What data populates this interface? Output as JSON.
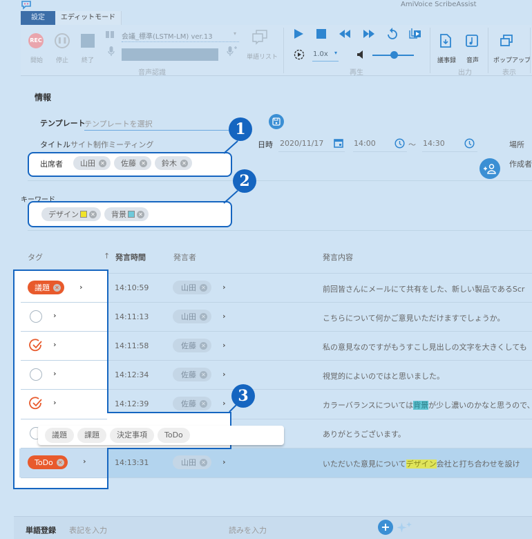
{
  "window": {
    "title": "AmiVoice ScribeAssist"
  },
  "tabs": [
    {
      "label": "設定",
      "active": true
    },
    {
      "label": "エディットモード",
      "active": false
    }
  ],
  "ribbon": {
    "recognition": {
      "group_label": "音声認識",
      "start_label": "開始",
      "start_icon_text": "REC",
      "pause_label": "停止",
      "end_label": "終了",
      "model": "会議_標準(LSTM-LM) ver.13",
      "word_list_label": "単語リスト"
    },
    "playback": {
      "group_label": "再生",
      "speed": "1.0x"
    },
    "output": {
      "group_label": "出力",
      "minutes_label": "議事録",
      "audio_label": "音声"
    },
    "display": {
      "group_label": "表示",
      "popup_label": "ポップアップ"
    }
  },
  "info": {
    "section_title": "情報",
    "template_label": "テンプレート",
    "template_placeholder": "テンプレートを選択",
    "title_label": "タイトル",
    "title_value": "サイト制作ミーティング",
    "datetime_label": "日時",
    "date": "2020/11/17",
    "start_time": "14:00",
    "tilde": "〜",
    "end_time": "14:30",
    "place_label": "場所",
    "creator_label": "作成者",
    "attendees_label": "出席者",
    "attendees": [
      "山田",
      "佐藤",
      "鈴木"
    ],
    "keywords_label": "キーワード",
    "keywords": [
      {
        "text": "デザイン",
        "color": "#f0e42a"
      },
      {
        "text": "背景",
        "color": "#6fcadb"
      }
    ]
  },
  "callouts": [
    "1",
    "2",
    "3"
  ],
  "table": {
    "headers": {
      "tag": "タグ",
      "time": "発言時間",
      "sort_arrow": "↑",
      "speaker": "発言者",
      "content": "発言内容"
    },
    "rows": [
      {
        "tag": "議題",
        "tag_type": "pill",
        "time": "14:10:59",
        "speaker": "山田",
        "content": "前回皆さんにメールにて共有をした、新しい製品であるScr"
      },
      {
        "tag": "",
        "tag_type": "empty",
        "time": "14:11:13",
        "speaker": "山田",
        "content": "こちらについて何かご意見いただけますでしょうか。"
      },
      {
        "tag": "",
        "tag_type": "check",
        "time": "14:11:58",
        "speaker": "佐藤",
        "content": "私の意見なのですがもうすこし見出しの文字を大きくしても"
      },
      {
        "tag": "",
        "tag_type": "empty",
        "time": "14:12:34",
        "speaker": "佐藤",
        "content": "視覚的によいのではと思いました。"
      },
      {
        "tag": "",
        "tag_type": "check",
        "time": "14:12:39",
        "speaker": "佐藤",
        "content_pre": "カラーバランスについては",
        "content_hl": "背景",
        "content_post": "が少し濃いのかなと思うので、"
      },
      {
        "tag": "",
        "tag_type": "popup",
        "time": "",
        "speaker": "",
        "content": "ありがとうございます。"
      },
      {
        "tag": "ToDo",
        "tag_type": "pill",
        "time": "14:13:31",
        "speaker": "山田",
        "content_pre": "いただいた意見について",
        "content_hl": "デザイン",
        "content_post": "会社と打ち合わせを設け",
        "selected": true
      }
    ],
    "tag_popup_options": [
      "議題",
      "課題",
      "決定事項",
      "ToDo"
    ]
  },
  "word_registration": {
    "label": "単語登録",
    "notation_placeholder": "表記を入力",
    "reading_placeholder": "読みを入力"
  },
  "colors": {
    "accent": "#2f86d0",
    "tag": "#e85a2c",
    "callout": "#1565c0",
    "tab_active": "#3c6ea8"
  }
}
